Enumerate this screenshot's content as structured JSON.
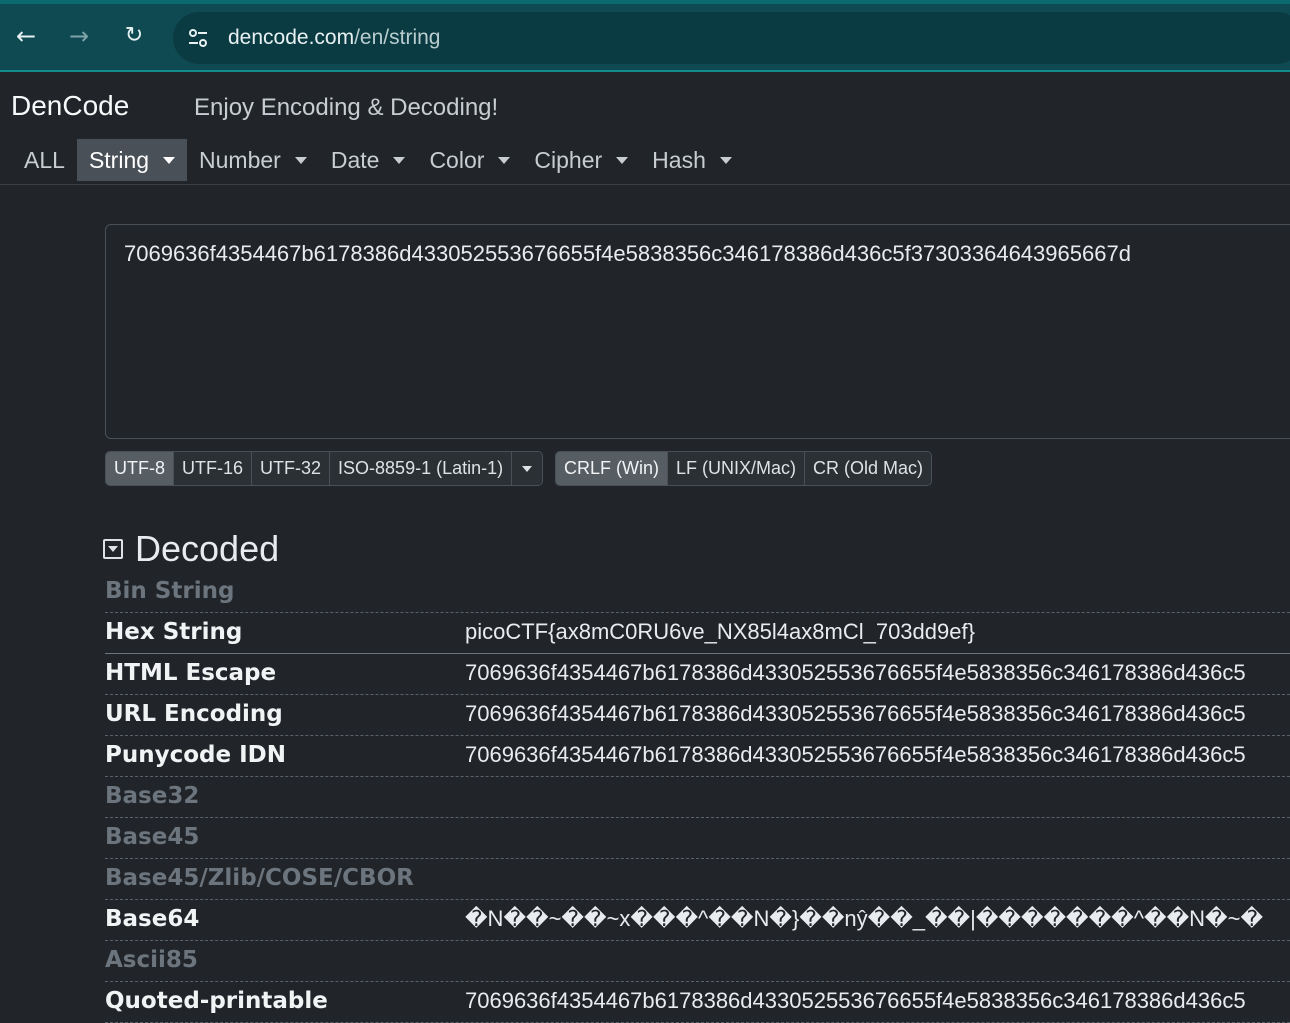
{
  "browser": {
    "url_host": "dencode.com",
    "url_path": "/en/string"
  },
  "header": {
    "brand": "DenCode",
    "tagline": "Enjoy Encoding & Decoding!",
    "tabs": [
      {
        "label": "ALL"
      },
      {
        "label": "String"
      },
      {
        "label": "Number"
      },
      {
        "label": "Date"
      },
      {
        "label": "Color"
      },
      {
        "label": "Cipher"
      },
      {
        "label": "Hash"
      }
    ],
    "active_tab": "String"
  },
  "input": {
    "value": "7069636f4354467b6178386d433052553676655f4e5838356c346178386d436c5f37303364643965667d"
  },
  "charset": {
    "options": [
      "UTF-8",
      "UTF-16",
      "UTF-32",
      "ISO-8859-1 (Latin-1)"
    ],
    "selected": "UTF-8"
  },
  "newline": {
    "options": [
      "CRLF (Win)",
      "LF (UNIX/Mac)",
      "CR (Old Mac)"
    ],
    "selected": "CRLF (Win)"
  },
  "decoded": {
    "title": "Decoded",
    "rows": [
      {
        "label": "Bin String",
        "value": ""
      },
      {
        "label": "Hex String",
        "value": "picoCTF{ax8mC0RU6ve_NX85l4ax8mCl_703dd9ef}"
      },
      {
        "label": "HTML Escape",
        "value": "7069636f4354467b6178386d433052553676655f4e5838356c346178386d436c5"
      },
      {
        "label": "URL Encoding",
        "value": "7069636f4354467b6178386d433052553676655f4e5838356c346178386d436c5"
      },
      {
        "label": "Punycode IDN",
        "value": "7069636f4354467b6178386d433052553676655f4e5838356c346178386d436c5"
      },
      {
        "label": "Base32",
        "value": ""
      },
      {
        "label": "Base45",
        "value": ""
      },
      {
        "label": "Base45/Zlib/COSE/CBOR",
        "value": ""
      },
      {
        "label": "Base64",
        "value": "�N��~��~x���^��N�}��nŷ��_��|�������^��N�~�"
      },
      {
        "label": "Ascii85",
        "value": ""
      },
      {
        "label": "Quoted-printable",
        "value": "7069636f4354467b6178386d433052553676655f4e5838356c346178386d436c5"
      }
    ]
  }
}
